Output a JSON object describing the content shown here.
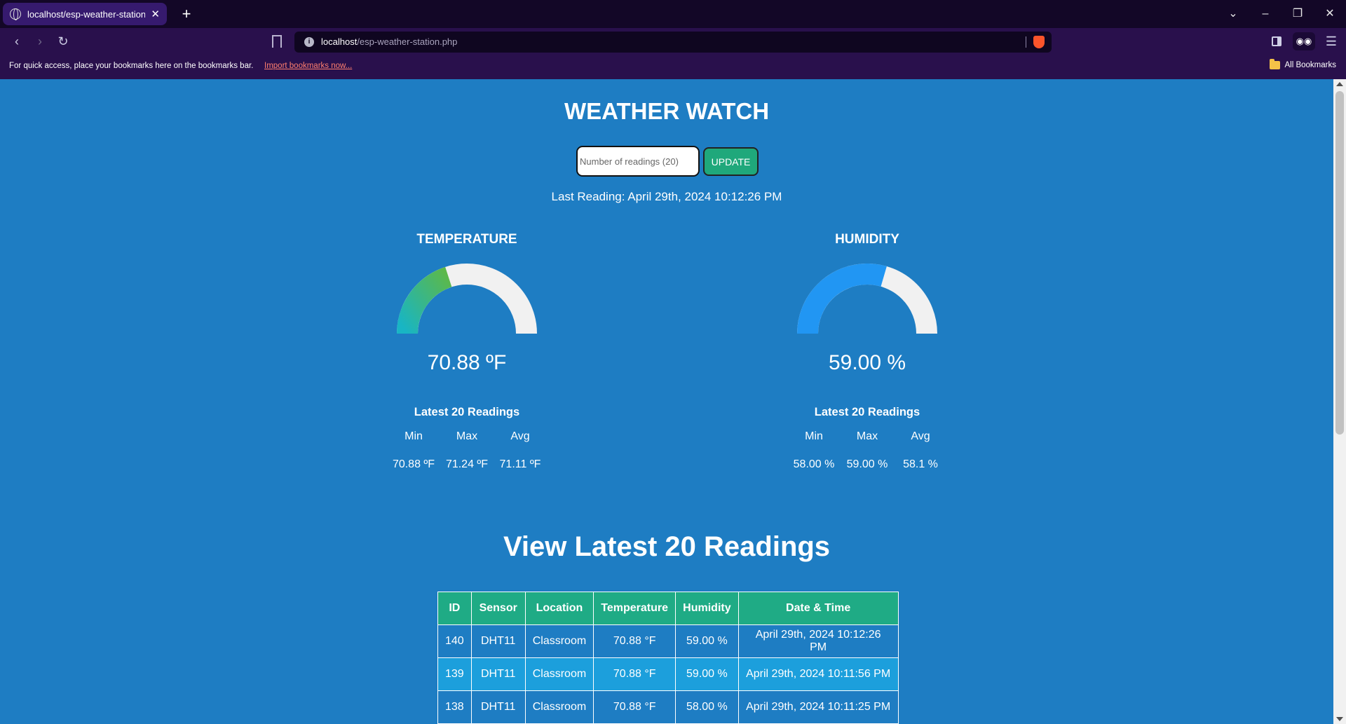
{
  "browser": {
    "tab_title": "localhost/esp-weather-station.php",
    "tab_close": "✕",
    "new_tab": "+",
    "url_host": "localhost",
    "url_path": "/esp-weather-station.php",
    "info_icon": "i",
    "bookmarks_hint": "For quick access, place your bookmarks here on the bookmarks bar.",
    "import_bookmarks": "Import bookmarks now...",
    "all_bookmarks": "All Bookmarks"
  },
  "page": {
    "title": "WEATHER WATCH",
    "input_placeholder": "Number of readings (20)",
    "update_label": "UPDATE",
    "last_reading": "Last Reading: April 29th, 2024 10:12:26 PM"
  },
  "temperature": {
    "heading": "TEMPERATURE",
    "value": "70.88 ºF",
    "gauge_fraction": 0.4,
    "stats_title": "Latest 20 Readings",
    "min_label": "Min",
    "max_label": "Max",
    "avg_label": "Avg",
    "min": "70.88 ºF",
    "max": "71.24 ºF",
    "avg": "71.11 ºF"
  },
  "humidity": {
    "heading": "HUMIDITY",
    "value": "59.00 %",
    "gauge_fraction": 0.59,
    "stats_title": "Latest 20 Readings",
    "min_label": "Min",
    "max_label": "Max",
    "avg_label": "Avg",
    "min": "58.00 %",
    "max": "59.00 %",
    "avg": "58.1 %"
  },
  "table": {
    "title": "View Latest 20 Readings",
    "headers": [
      "ID",
      "Sensor",
      "Location",
      "Temperature",
      "Humidity",
      "Date & Time"
    ],
    "rows": [
      [
        "140",
        "DHT11",
        "Classroom",
        "70.88 °F",
        "59.00 %",
        "April 29th, 2024 10:12:26 PM"
      ],
      [
        "139",
        "DHT11",
        "Classroom",
        "70.88 °F",
        "59.00 %",
        "April 29th, 2024 10:11:56 PM"
      ],
      [
        "138",
        "DHT11",
        "Classroom",
        "70.88 °F",
        "58.00 %",
        "April 29th, 2024 10:11:25 PM"
      ]
    ]
  },
  "colors": {
    "page_bg": "#1e7dc3",
    "accent_green": "#1fab85",
    "gauge_track": "#f1f1f1",
    "humidity_fill": "#2196f3",
    "temp_grad_start": "#18b5c4",
    "temp_grad_end": "#5cb84a"
  }
}
